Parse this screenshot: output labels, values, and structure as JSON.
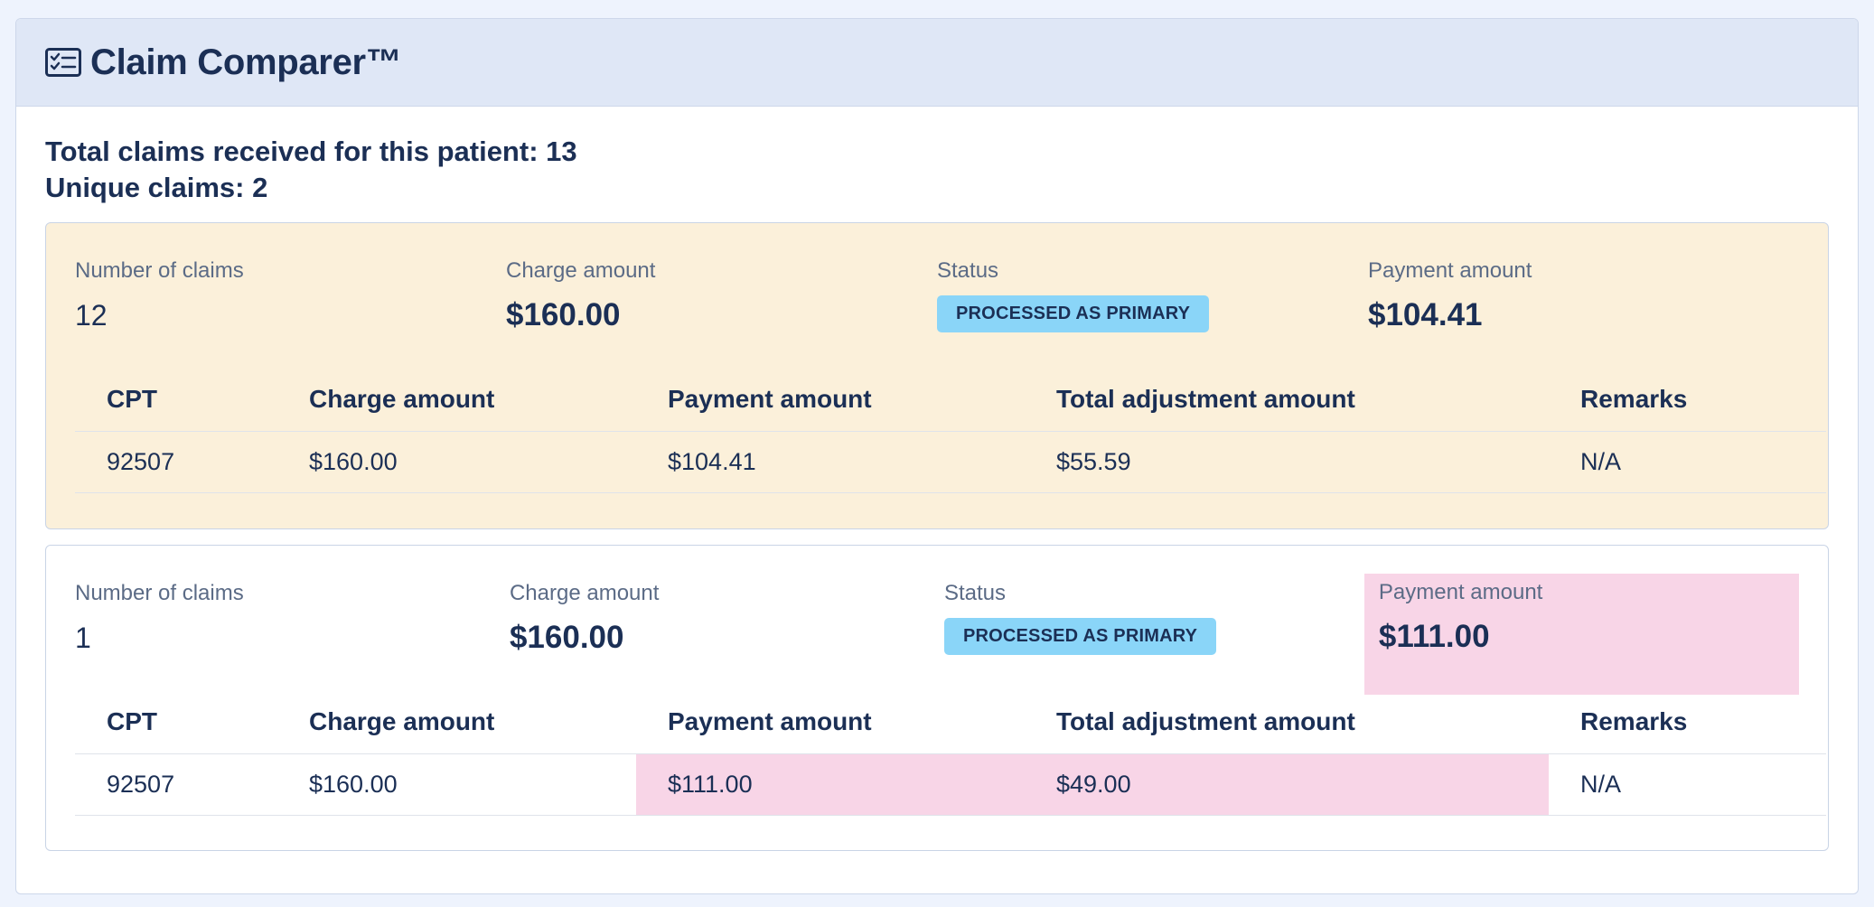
{
  "app": {
    "title": "Claim Comparer™",
    "header_icon": "checklist-card-icon"
  },
  "summary": {
    "total_claims": "Total claims received for this patient: 13",
    "unique_claims": "Unique claims: 2"
  },
  "colors": {
    "primary_card_bg": "#fbf0da",
    "badge_bg": "#8ad5f8",
    "difference_highlight": "#f8d5e7",
    "text": "#1b2f55"
  },
  "table_headers": {
    "cpt": "CPT",
    "charge": "Charge amount",
    "payment": "Payment amount",
    "adjustment": "Total adjustment amount",
    "remarks": "Remarks"
  },
  "stat_labels": {
    "count": "Number of claims",
    "charge": "Charge amount",
    "status": "Status",
    "payment": "Payment amount"
  },
  "claims": [
    {
      "count": "12",
      "charge": "$160.00",
      "status": "PROCESSED AS PRIMARY",
      "payment": "$104.41",
      "lines": [
        {
          "cpt": "92507",
          "charge": "$160.00",
          "payment": "$104.41",
          "adjustment": "$55.59",
          "remarks": "N/A"
        }
      ]
    },
    {
      "count": "1",
      "charge": "$160.00",
      "status": "PROCESSED AS PRIMARY",
      "payment": "$111.00",
      "lines": [
        {
          "cpt": "92507",
          "charge": "$160.00",
          "payment": "$111.00",
          "adjustment": "$49.00",
          "remarks": "N/A"
        }
      ]
    }
  ]
}
